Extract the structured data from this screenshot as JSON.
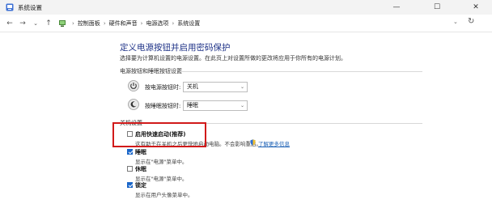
{
  "window": {
    "title": "系统设置",
    "minimize_glyph": "—",
    "maximize_glyph": "☐",
    "close_glyph": "✕"
  },
  "nav": {
    "back_glyph": "←",
    "forward_glyph": "→",
    "recent_glyph": "⌄",
    "up_glyph": "↑",
    "refresh_glyph": "↻",
    "breadcrumb": [
      "控制面板",
      "硬件和声音",
      "电源选项",
      "系统设置"
    ],
    "separator": "›",
    "dropdown_glyph": "⌄"
  },
  "page": {
    "title": "定义电源按钮并启用密码保护",
    "description": "选择要为计算机设置的电源设置。在此页上对设置所做的更改将应用于你所有的电源计划。"
  },
  "button_settings": {
    "section_label": "电源按钮和睡眠按钮设置",
    "power_button_label": "按电源按钮时:",
    "power_button_value": "关机",
    "sleep_button_label": "按睡眠按钮时:",
    "sleep_button_value": "睡眠",
    "select_chevron": "⌄"
  },
  "shutdown_settings": {
    "section_label": "关机设置",
    "options": [
      {
        "title": "启用快速启动(推荐)",
        "desc": "这有助于在关机之后更快地启动电脑。不会影响重启。",
        "checked": false
      },
      {
        "title": "睡眠",
        "desc": "显示在\"电源\"菜单中。",
        "checked": true
      },
      {
        "title": "休眠",
        "desc": "显示在\"电源\"菜单中。",
        "checked": false
      },
      {
        "title": "锁定",
        "desc": "显示在用户头像菜单中。",
        "checked": true
      }
    ],
    "learn_more_link": "了解更多信息"
  },
  "colors": {
    "accent": "#1a66c9",
    "title_blue": "#1e3287",
    "highlight_red": "#d11a1a"
  },
  "icons": {
    "app": "settings-icon",
    "control_panel": "control-panel-icon",
    "power_button": "power-button-icon",
    "sleep_button": "sleep-button-icon",
    "shield": "uac-shield-icon"
  }
}
